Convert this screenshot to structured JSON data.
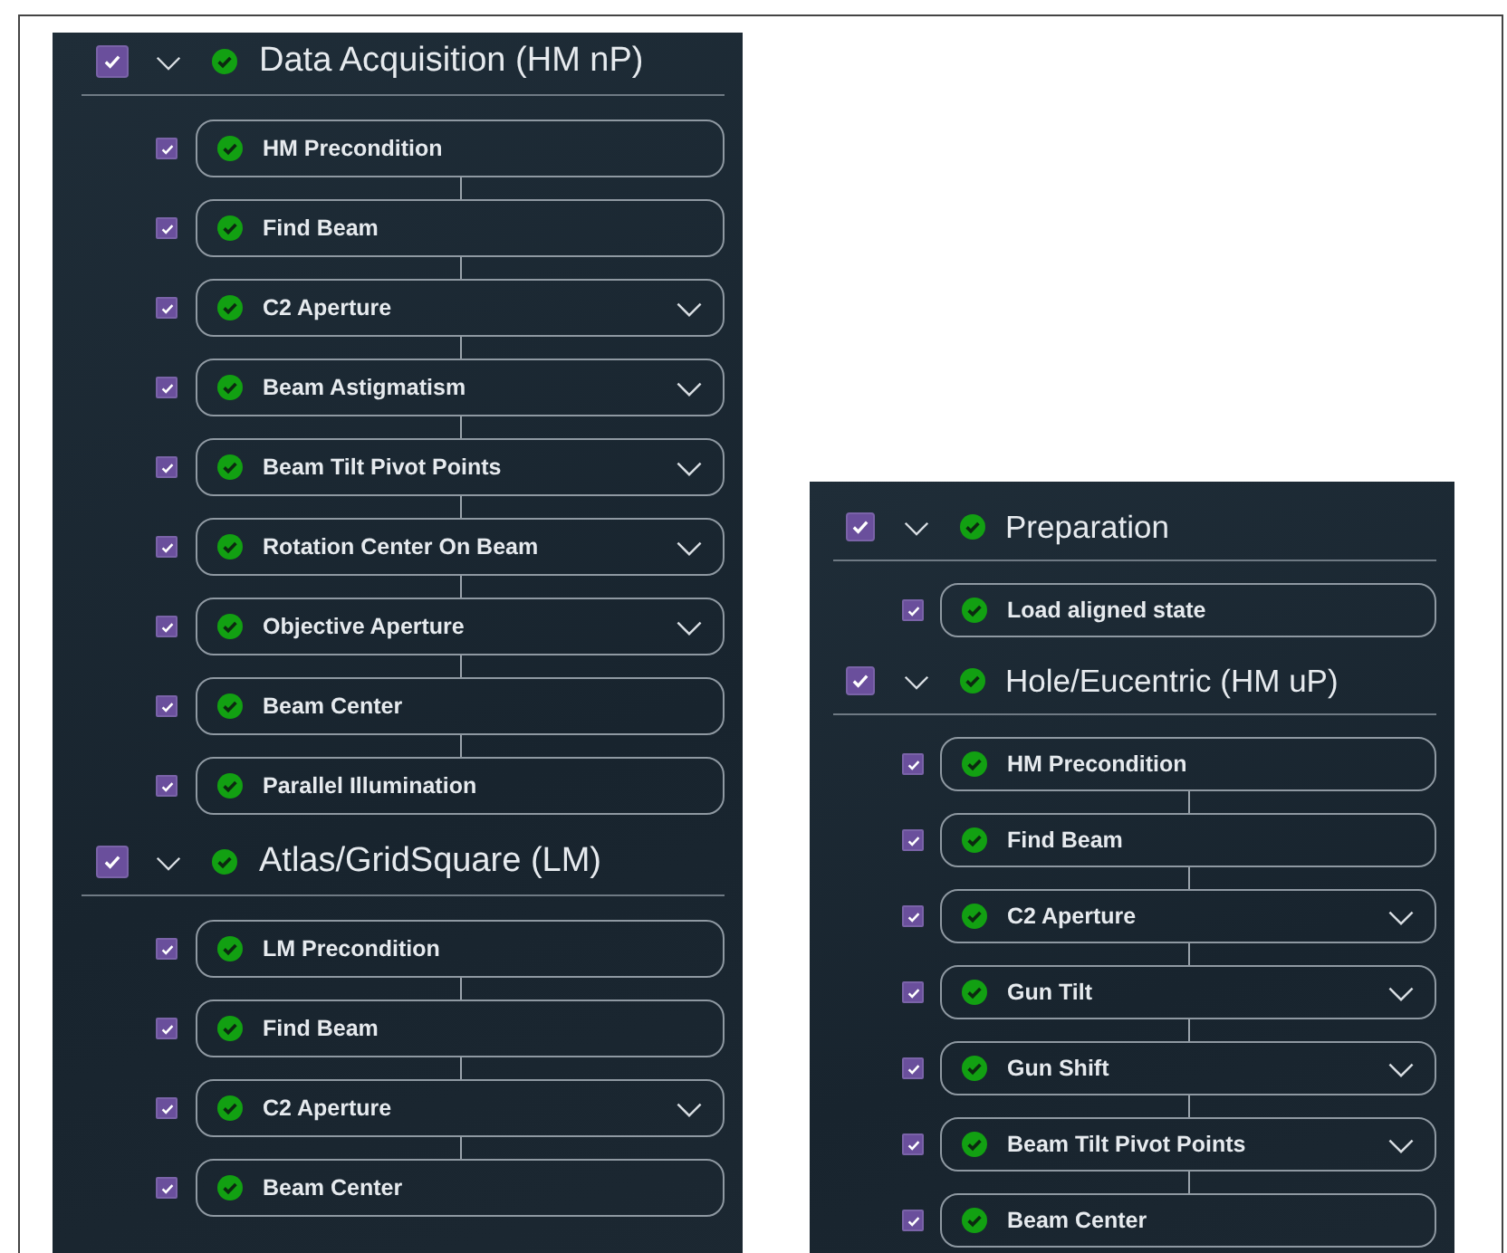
{
  "panels": [
    {
      "sections": [
        {
          "title": "Data Acquisition (HM nP)",
          "checked": true,
          "expanded": true,
          "done": true,
          "steps": [
            {
              "label": "HM Precondition",
              "checked": true,
              "done": true,
              "expandable": false
            },
            {
              "label": "Find Beam",
              "checked": true,
              "done": true,
              "expandable": false
            },
            {
              "label": "C2 Aperture",
              "checked": true,
              "done": true,
              "expandable": true
            },
            {
              "label": "Beam Astigmatism",
              "checked": true,
              "done": true,
              "expandable": true
            },
            {
              "label": "Beam Tilt Pivot Points",
              "checked": true,
              "done": true,
              "expandable": true
            },
            {
              "label": "Rotation Center On Beam",
              "checked": true,
              "done": true,
              "expandable": true
            },
            {
              "label": "Objective Aperture",
              "checked": true,
              "done": true,
              "expandable": true
            },
            {
              "label": "Beam Center",
              "checked": true,
              "done": true,
              "expandable": false
            },
            {
              "label": "Parallel Illumination",
              "checked": true,
              "done": true,
              "expandable": false
            }
          ]
        },
        {
          "title": "Atlas/GridSquare (LM)",
          "checked": true,
          "expanded": true,
          "done": true,
          "steps": [
            {
              "label": "LM Precondition",
              "checked": true,
              "done": true,
              "expandable": false
            },
            {
              "label": "Find Beam",
              "checked": true,
              "done": true,
              "expandable": false
            },
            {
              "label": "C2 Aperture",
              "checked": true,
              "done": true,
              "expandable": true
            },
            {
              "label": "Beam Center",
              "checked": true,
              "done": true,
              "expandable": false
            }
          ]
        }
      ]
    },
    {
      "sections": [
        {
          "title": "Preparation",
          "checked": true,
          "expanded": true,
          "done": true,
          "steps": [
            {
              "label": "Load aligned state",
              "checked": true,
              "done": true,
              "expandable": false
            }
          ]
        },
        {
          "title": "Hole/Eucentric (HM uP)",
          "checked": true,
          "expanded": true,
          "done": true,
          "steps": [
            {
              "label": "HM Precondition",
              "checked": true,
              "done": true,
              "expandable": false
            },
            {
              "label": "Find Beam",
              "checked": true,
              "done": true,
              "expandable": false
            },
            {
              "label": "C2 Aperture",
              "checked": true,
              "done": true,
              "expandable": true
            },
            {
              "label": "Gun Tilt",
              "checked": true,
              "done": true,
              "expandable": true
            },
            {
              "label": "Gun Shift",
              "checked": true,
              "done": true,
              "expandable": true
            },
            {
              "label": "Beam Tilt Pivot Points",
              "checked": true,
              "done": true,
              "expandable": true
            },
            {
              "label": "Beam Center",
              "checked": true,
              "done": true,
              "expandable": false
            }
          ]
        }
      ]
    }
  ]
}
